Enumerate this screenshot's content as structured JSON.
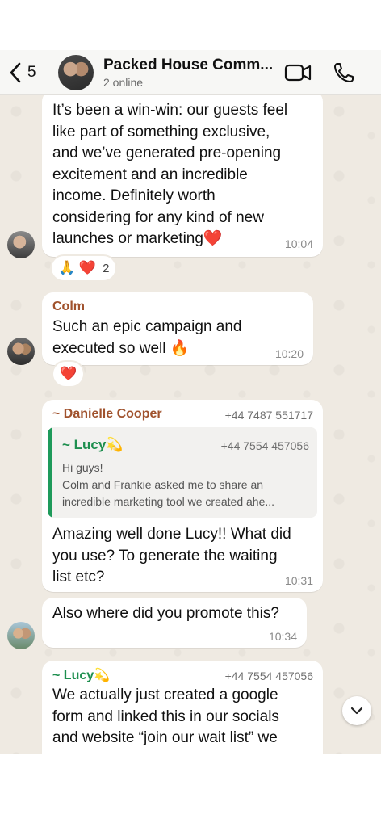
{
  "header": {
    "back_count": "5",
    "title": "Packed House Comm...",
    "subtitle": "2 online",
    "icons": [
      "chevron-left-icon",
      "video-camera-icon",
      "phone-icon"
    ]
  },
  "messages": [
    {
      "lines": [
        "It’s been a win-win: our guests feel",
        "like part of something exclusive,",
        "and we’ve generated pre-opening",
        "excitement and an incredible",
        "income. Definitely worth",
        "considering for any kind of new",
        "launches or marketing❤️"
      ],
      "time": "10:04",
      "reactions": {
        "emojis": "🙏 ❤️",
        "count": "2"
      }
    },
    {
      "sender": "Colm",
      "sender_color": "#a0522d",
      "lines": [
        "Such an epic campaign and",
        "executed so well 🔥"
      ],
      "time": "10:20",
      "reactions": {
        "emojis": "❤️"
      }
    },
    {
      "sender": "~ Danielle Cooper",
      "sender_color": "#a0522d",
      "phone": "+44 7487 551717",
      "quote": {
        "sender": "~ Lucy💫",
        "phone": "+44 7554 457056",
        "lines": [
          "Hi guys!",
          "Colm and Frankie asked me to share an",
          "incredible marketing tool we created ahe..."
        ]
      },
      "lines": [
        "Amazing well done Lucy!! What did",
        "you use? To generate the waiting",
        "list etc?"
      ],
      "time": "10:31"
    },
    {
      "lines": [
        "Also where did you promote this?"
      ],
      "time": "10:34"
    },
    {
      "sender": "~ Lucy💫",
      "sender_color": "#1e8f4f",
      "phone": "+44 7554 457056",
      "lines": [
        "We actually just created a google",
        "form and linked this in our socials",
        "and website “join our wait list” we"
      ]
    }
  ],
  "scroll_button_icon": "chevron-down-icon"
}
